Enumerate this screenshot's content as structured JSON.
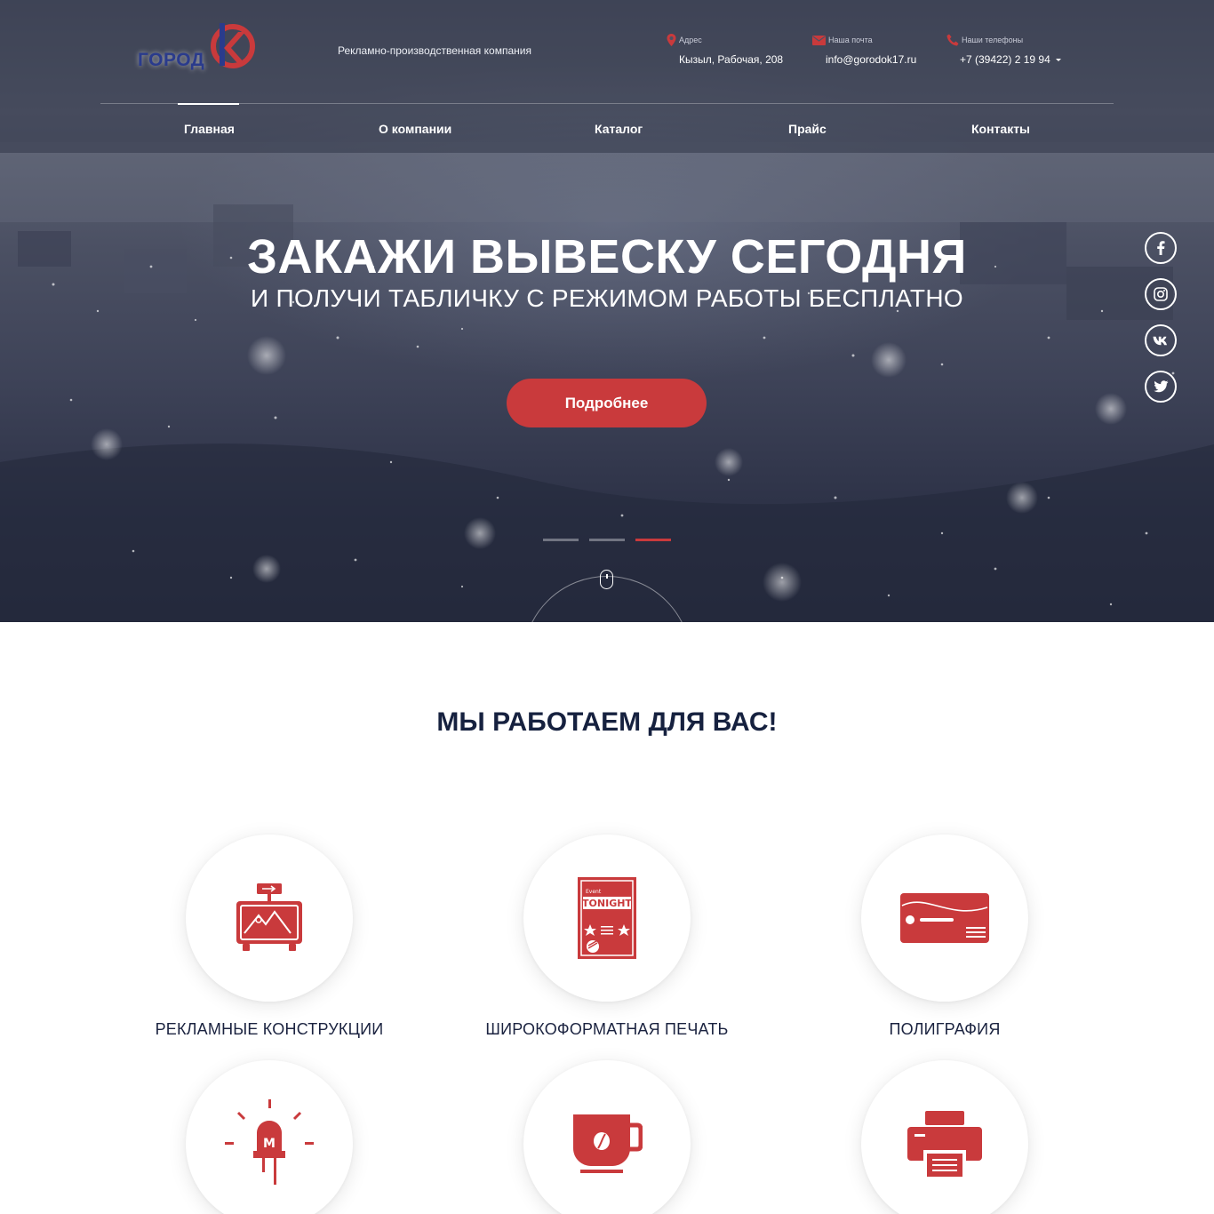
{
  "header": {
    "logo_text": "ГОРОД",
    "tagline": "Рекламно-производственная компания",
    "contacts": {
      "address_label": "Адрес",
      "address": "Кызыл, Рабочая, 208",
      "email_label": "Наша почта",
      "email": "info@gorodok17.ru",
      "phone_label": "Наши телефоны",
      "phone": "+7 (39422) 2 19 94"
    },
    "nav": [
      "Главная",
      "О компании",
      "Каталог",
      "Прайс",
      "Контакты"
    ],
    "nav_active": "Главная"
  },
  "hero": {
    "title": "ЗАКАЖИ ВЫВЕСКУ СЕГОДНЯ",
    "subtitle": "И ПОЛУЧИ ТАБЛИЧКУ С РЕЖИМОМ РАБОТЫ БЕСПЛАТНО",
    "button": "Подробнее",
    "slides_total": 3,
    "slide_active": 3,
    "social": [
      "facebook-icon",
      "instagram-icon",
      "vk-icon",
      "twitter-icon"
    ]
  },
  "services": {
    "title": "МЫ РАБОТАЕМ ДЛЯ ВАС!",
    "items": [
      {
        "label": "РЕКЛАМНЫЕ КОНСТРУКЦИИ",
        "icon": "billboard-icon"
      },
      {
        "label": "ШИРОКОФОРМАТНАЯ ПЕЧАТЬ",
        "icon": "poster-icon",
        "icon_text_small": "Event",
        "icon_text": "TONIGHT"
      },
      {
        "label": "ПОЛИГРАФИЯ",
        "icon": "business-card-icon"
      },
      {
        "label": "",
        "icon": "led-icon",
        "icon_text": "M"
      },
      {
        "label": "",
        "icon": "mug-icon"
      },
      {
        "label": "",
        "icon": "printer-icon"
      }
    ]
  },
  "colors": {
    "accent": "#c93a3c",
    "header_bg": "#4d5264",
    "title_dark": "#16213f",
    "logo_blue": "#2a3b8c"
  }
}
